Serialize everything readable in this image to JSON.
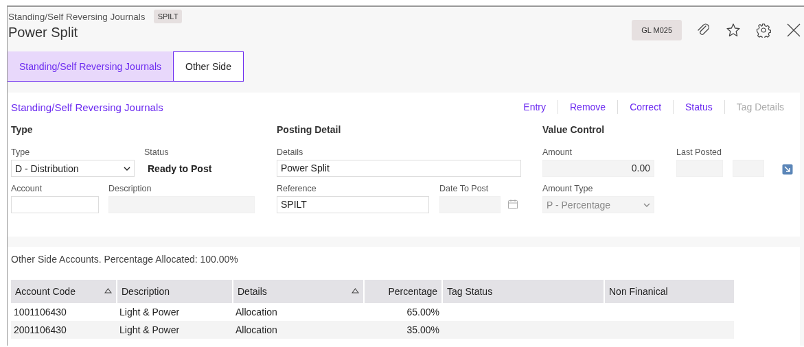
{
  "header": {
    "breadcrumb": "Standing/Self Reversing Journals",
    "code_badge": "SPILT",
    "title": "Power Split",
    "program_badge": "GL M025"
  },
  "tabs": [
    {
      "label": "Standing/Self Reversing Journals",
      "selected": true
    },
    {
      "label": "Other Side",
      "selected": false
    }
  ],
  "form": {
    "title": "Standing/Self Reversing Journals",
    "actions": [
      {
        "label": "Entry",
        "disabled": false
      },
      {
        "label": "Remove",
        "disabled": false
      },
      {
        "label": "Correct",
        "disabled": false
      },
      {
        "label": "Status",
        "disabled": false
      },
      {
        "label": "Tag Details",
        "disabled": true
      }
    ],
    "sections": {
      "type": "Type",
      "posting": "Posting Detail",
      "value": "Value Control"
    },
    "type_field": {
      "label": "Type",
      "value": "D - Distribution",
      "disabled": false
    },
    "status": {
      "label": "Status",
      "value": "Ready to Post"
    },
    "details": {
      "label": "Details",
      "value": "Power Split"
    },
    "account": {
      "label": "Account",
      "disabled": false
    },
    "description": {
      "label": "Description",
      "disabled": true
    },
    "reference": {
      "label": "Reference",
      "value": "SPILT"
    },
    "date_to_post": {
      "label": "Date To Post",
      "disabled": true
    },
    "amount": {
      "label": "Amount",
      "value": "0.00",
      "disabled": true
    },
    "last_posted": {
      "label": "Last Posted",
      "disabled": true
    },
    "amount_type": {
      "label": "Amount Type",
      "value": "P - Percentage",
      "disabled": true
    }
  },
  "table": {
    "caption": "Other Side Accounts.  Percentage Allocated: 100.00%",
    "columns": [
      {
        "label": "Account Code",
        "sortable": true,
        "kind": "text"
      },
      {
        "label": "Description",
        "sortable": false,
        "kind": "text"
      },
      {
        "label": "Details",
        "sortable": true,
        "kind": "text"
      },
      {
        "label": "Percentage",
        "sortable": false,
        "kind": "number"
      },
      {
        "label": "Tag Status",
        "sortable": false,
        "kind": "text"
      },
      {
        "label": "Non Finanical",
        "sortable": false,
        "kind": "text"
      }
    ],
    "rows": [
      [
        "1001106430",
        "Light & Power",
        "Allocation",
        "65.00%"
      ],
      [
        "2001106430",
        "Light & Power",
        "Allocation",
        "35.00%"
      ]
    ]
  }
}
